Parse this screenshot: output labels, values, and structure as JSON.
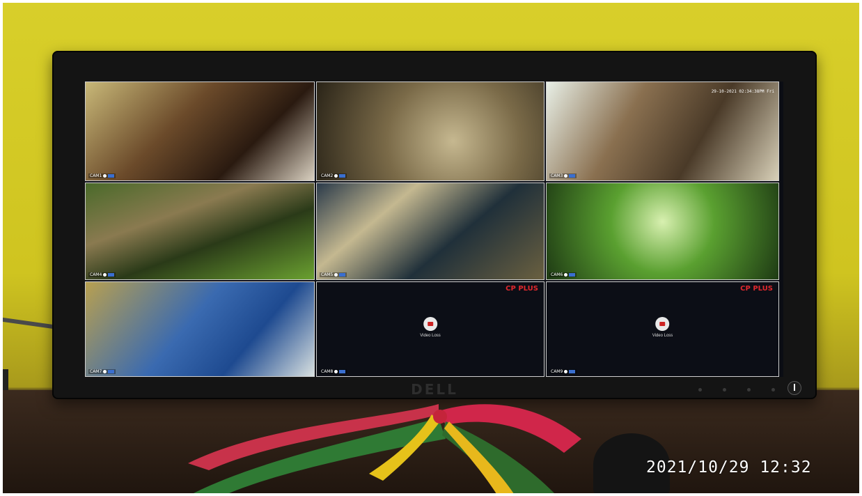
{
  "photo_timestamp": "2021/10/29  12:32",
  "monitor_brand": "DELL",
  "nvr": {
    "brand": "CP PLUS",
    "osd_timestamp": "29-10-2021 02:34:38PM Fri",
    "video_loss_text": "Video Loss",
    "cameras": [
      {
        "label": "CAM1"
      },
      {
        "label": "CAM2"
      },
      {
        "label": "CAM3"
      },
      {
        "label": "CAM4"
      },
      {
        "label": "CAM5"
      },
      {
        "label": "CAM6"
      },
      {
        "label": "CAM7"
      },
      {
        "label": "CAM8"
      },
      {
        "label": "CAM9"
      }
    ]
  }
}
